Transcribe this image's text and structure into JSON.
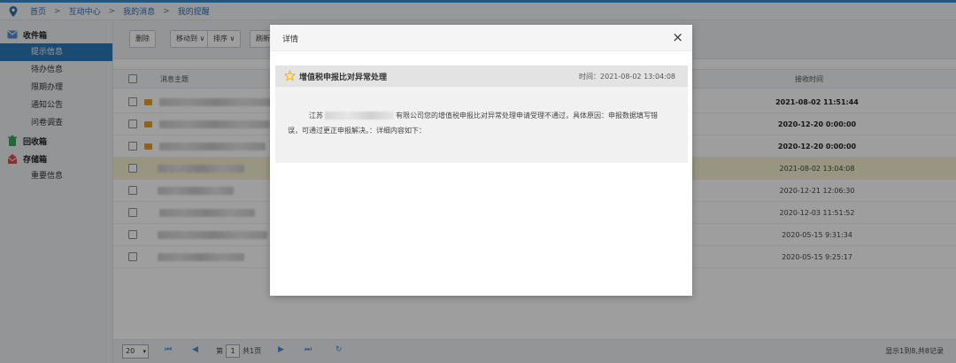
{
  "breadcrumb": {
    "items": [
      "首页",
      "互动中心",
      "我的消息",
      "我的提醒"
    ],
    "separator": ">"
  },
  "sidebar": {
    "groups": [
      {
        "label": "收件箱",
        "icon": "inbox-icon",
        "items": [
          {
            "label": "提示信息",
            "active": true
          },
          {
            "label": "待办信息",
            "active": false
          },
          {
            "label": "限期办理",
            "active": false
          },
          {
            "label": "通知公告",
            "active": false
          },
          {
            "label": "问卷调查",
            "active": false
          }
        ]
      },
      {
        "label": "回收箱",
        "icon": "trash-icon",
        "items": []
      },
      {
        "label": "存储箱",
        "icon": "storage-icon",
        "items": [
          {
            "label": "重要信息",
            "active": false
          }
        ]
      }
    ]
  },
  "toolbar": {
    "delete_label": "删除",
    "move_label": "移动到",
    "sort_label": "排序",
    "refresh_label": "刷新"
  },
  "table": {
    "columns": [
      "消息主题",
      "接收时间"
    ],
    "rows": [
      {
        "time": "2021-08-02 11:51:44",
        "unread": true
      },
      {
        "time": "2020-12-20 0:00:00",
        "unread": true
      },
      {
        "time": "2020-12-20 0:00:00",
        "unread": true
      },
      {
        "time": "2021-08-02 13:04:08",
        "unread": false,
        "highlight": true
      },
      {
        "time": "2020-12-21 12:06:30",
        "unread": false
      },
      {
        "time": "2020-12-03 11:51:52",
        "unread": false
      },
      {
        "time": "2020-05-15 9:31:34",
        "unread": false
      },
      {
        "time": "2020-05-15 9:25:17",
        "unread": false
      }
    ]
  },
  "pager": {
    "page_size": "20",
    "page_prefix": "第",
    "page_value": "1",
    "page_total": "共1页",
    "summary": "显示1到8,共8记录"
  },
  "modal": {
    "title": "详情",
    "close": "×",
    "subject": "增值税申报比对异常处理",
    "time": "时间：2021-08-02 13:04:08",
    "body_prefix": "江苏",
    "body_text": "有限公司您的增值税申报比对异常处理申请受理不通过，具体原因：申报数据填写错误，可通过更正申报解决。：详细内容如下："
  },
  "colors": {
    "accent": "#2a7ab8",
    "link": "#2c6fb3",
    "highlight_row": "#f5f3cf",
    "unread_envelope": "#e8a21c",
    "star": "#f0b429"
  }
}
